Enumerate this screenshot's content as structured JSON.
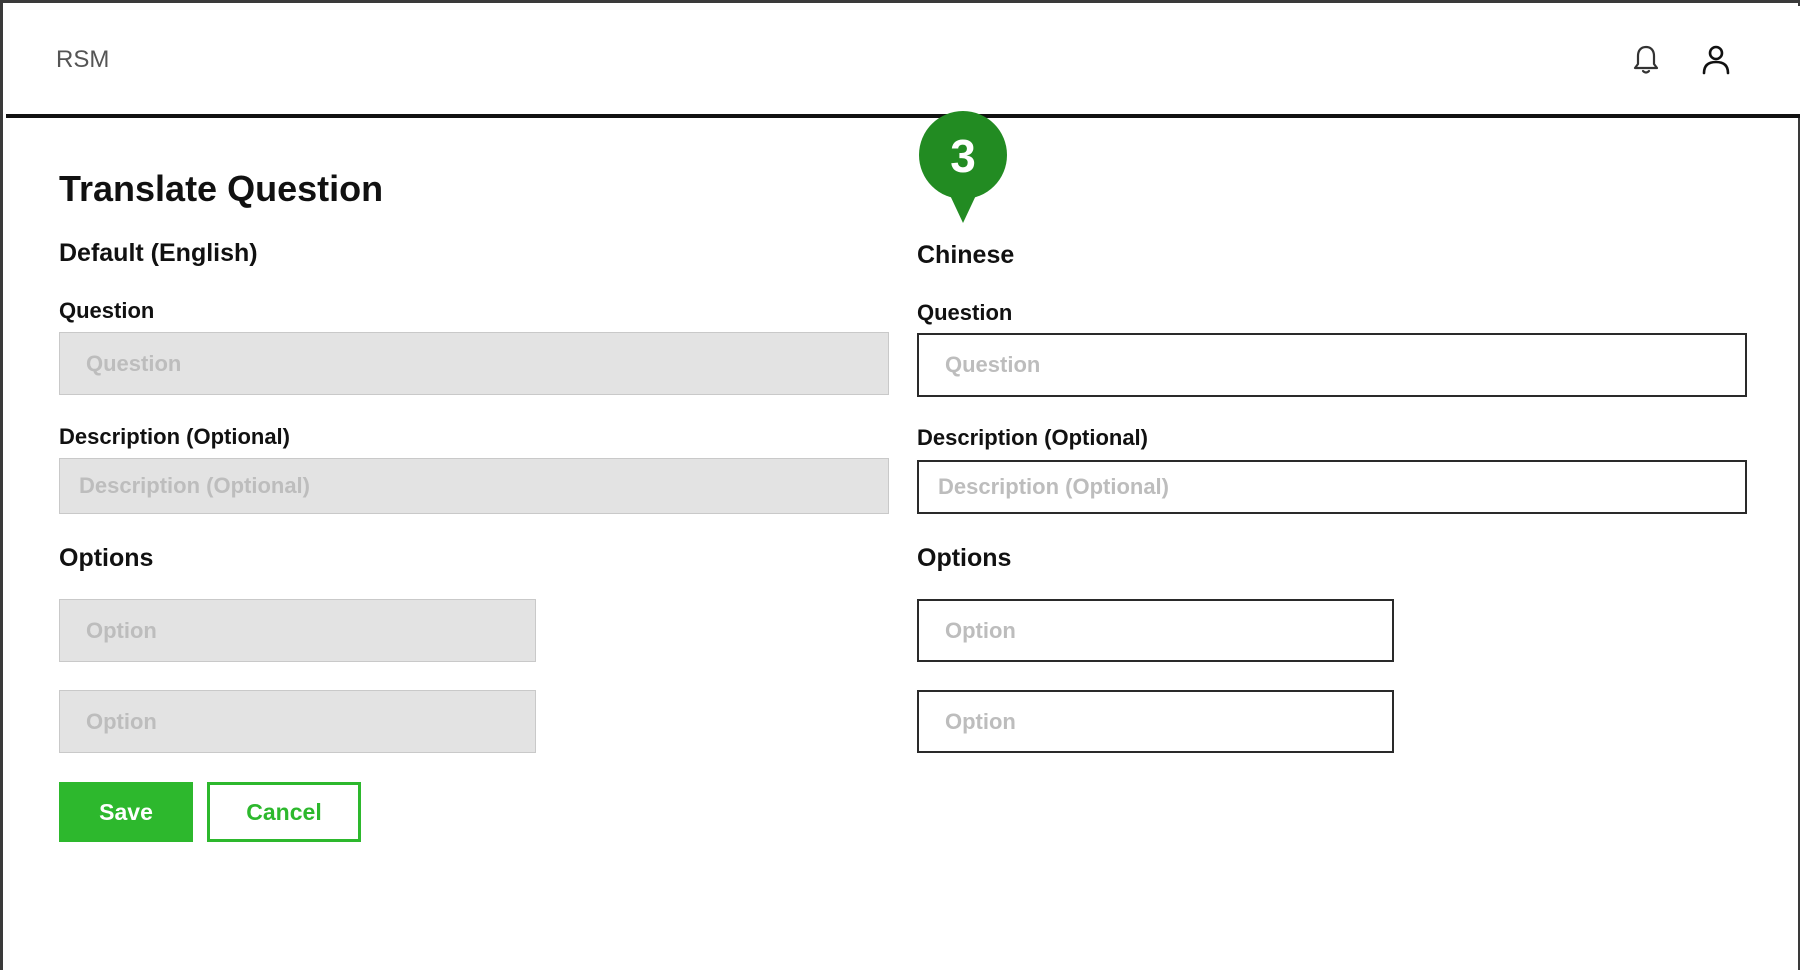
{
  "app": {
    "title": "RSM"
  },
  "header": {
    "icons": [
      "bell-icon",
      "user-icon"
    ]
  },
  "step_marker": {
    "number": "3",
    "color": "#228b22"
  },
  "page": {
    "title": "Translate Question"
  },
  "default_column": {
    "heading": "Default (English)",
    "question_label": "Question",
    "question_placeholder": "Question",
    "description_label": "Description (Optional)",
    "description_placeholder": "Description (Optional)",
    "options_heading": "Options",
    "options": [
      {
        "placeholder": "Option"
      },
      {
        "placeholder": "Option"
      }
    ]
  },
  "translation_column": {
    "heading": "Chinese",
    "question_label": "Question",
    "question_placeholder": "Question",
    "description_label": "Description (Optional)",
    "description_placeholder": "Description (Optional)",
    "options_heading": "Options",
    "options": [
      {
        "placeholder": "Option"
      },
      {
        "placeholder": "Option"
      }
    ]
  },
  "actions": {
    "save_label": "Save",
    "cancel_label": "Cancel"
  },
  "colors": {
    "accent": "#2db82d",
    "disabled_bg": "#e3e3e3",
    "placeholder": "#bdbdbd"
  }
}
